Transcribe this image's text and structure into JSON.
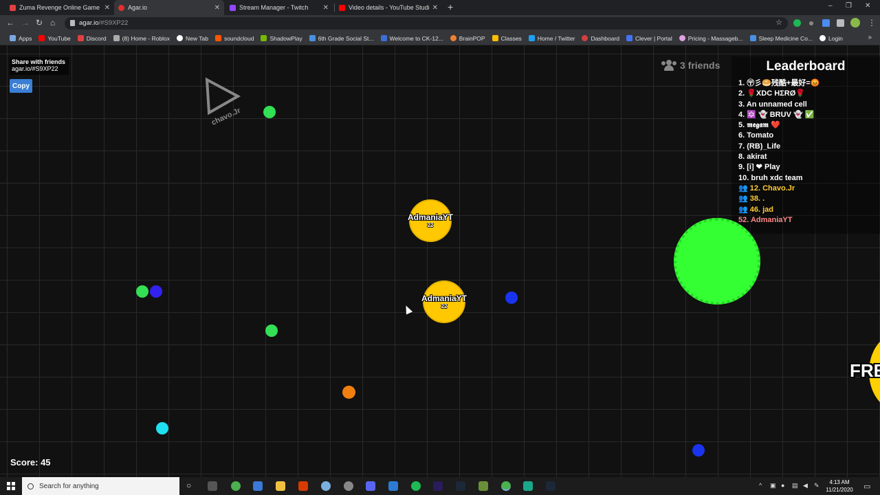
{
  "browser": {
    "tabs": [
      {
        "title": "Zuma Revenge Online Game in F",
        "favicon_color": "#e04040",
        "active": false
      },
      {
        "title": "Agar.io",
        "favicon_color": "#d0d0d0",
        "active": true
      },
      {
        "title": "Stream Manager - Twitch",
        "favicon_color": "#9147ff",
        "active": false
      },
      {
        "title": "Video details - YouTube Studio",
        "favicon_color": "#ff0000",
        "active": false
      }
    ],
    "new_tab_glyph": "+",
    "url_host": "agar.io",
    "url_path": "/#S9XP22",
    "bookmarks": [
      {
        "label": "Apps",
        "color": "#7aa7e0"
      },
      {
        "label": "YouTube",
        "color": "#ff0000"
      },
      {
        "label": "Discord",
        "color": "#e04040"
      },
      {
        "label": "(8) Home - Roblox",
        "color": "#aaaaaa"
      },
      {
        "label": "New Tab",
        "color": "#ffffff"
      },
      {
        "label": "soundcloud",
        "color": "#ff5500"
      },
      {
        "label": "ShadowPlay",
        "color": "#76b900"
      },
      {
        "label": "6th Grade Social St...",
        "color": "#4a90e2"
      },
      {
        "label": "Welcome to CK-12...",
        "color": "#3b6fd6"
      },
      {
        "label": "BrainPOP",
        "color": "#f08030"
      },
      {
        "label": "Classes",
        "color": "#fbbc04"
      },
      {
        "label": "Home / Twitter",
        "color": "#1da1f2"
      },
      {
        "label": "Dashboard",
        "color": "#d04040"
      },
      {
        "label": "Clever | Portal",
        "color": "#4274f6"
      },
      {
        "label": "Pricing - Massageb...",
        "color": "#e0a0e0"
      },
      {
        "label": "Sleep Medicine Co...",
        "color": "#4a90e2"
      },
      {
        "label": "Login",
        "color": "#ffffff"
      }
    ]
  },
  "game": {
    "share_title": "Share with friends",
    "share_link": "agar.io/#S9XP22",
    "copy_label": "Copy",
    "friends_label": "3 friends",
    "leaderboard_title": "Leaderboard",
    "leaderboard": [
      {
        "text": "1. 〶彡🥯残酷+最好=😡",
        "style": "normal"
      },
      {
        "text": "2. 🌹XDC HΣRØ🌹",
        "style": "normal"
      },
      {
        "text": "3. An unnamed cell",
        "style": "normal"
      },
      {
        "text": "4. 🔯 👻 BRUV 👻 ✅",
        "style": "normal"
      },
      {
        "text": "5. 𝖒𝖊𝖌𝖆𝖒 ❤️",
        "style": "normal"
      },
      {
        "text": "6. Tomato",
        "style": "normal"
      },
      {
        "text": "7. (RB)_Life",
        "style": "normal"
      },
      {
        "text": "8. akirat",
        "style": "normal"
      },
      {
        "text": "9. [i] ❤ Play",
        "style": "normal"
      },
      {
        "text": "10. bruh xdc team",
        "style": "normal"
      },
      {
        "text": "👥 12. Chavo.Jr",
        "style": "yellow"
      },
      {
        "text": "👥 38. .",
        "style": "yellow"
      },
      {
        "text": "👥 46. jad",
        "style": "yellow"
      },
      {
        "text": "52. AdmaniaYT",
        "style": "me"
      }
    ],
    "player_name": "AdmaniaYT",
    "player_mass": "22",
    "skin_tag": "chavo.Jr",
    "free_text": "FRE",
    "score_label": "Score: 45",
    "colors": {
      "player": "#ffc800",
      "virus": "#33ff33",
      "grid": "#2a2a2a",
      "background": "#111111"
    }
  },
  "taskbar": {
    "search_placeholder": "Search for anything",
    "time": "4:13 AM",
    "date": "11/21/2020"
  }
}
